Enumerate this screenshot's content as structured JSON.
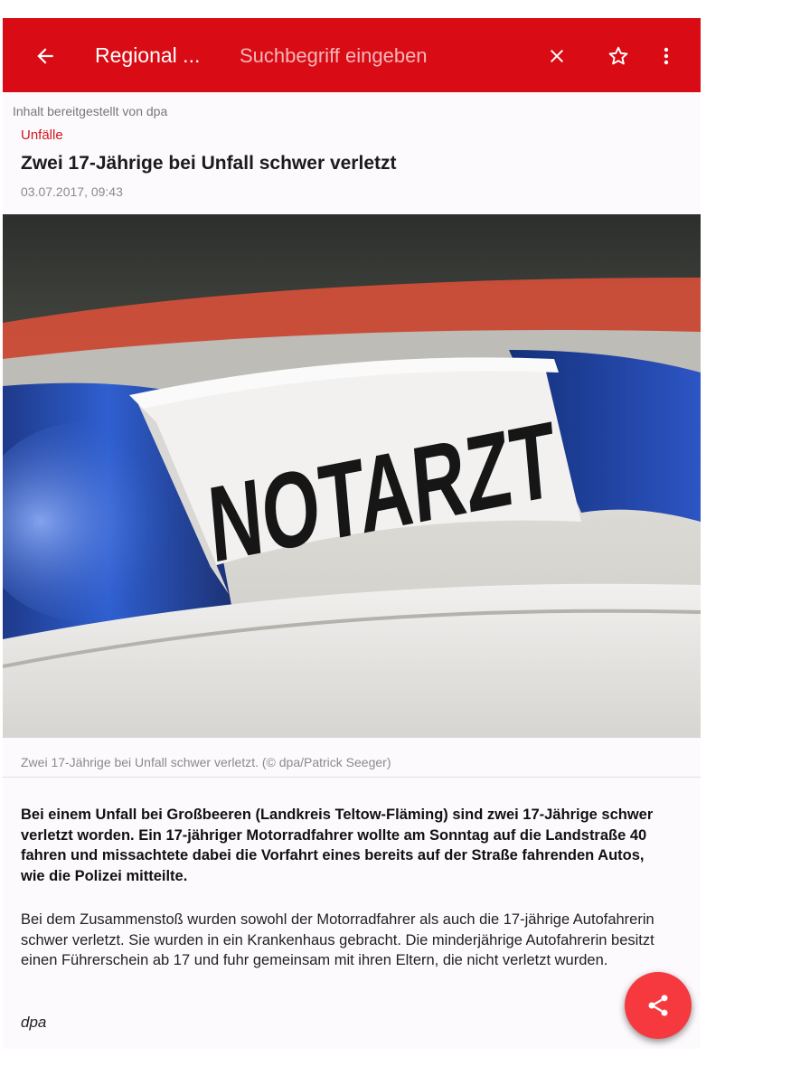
{
  "toolbar": {
    "title": "Regional ...",
    "search_placeholder": "Suchbegriff eingeben",
    "back_icon": "arrow-left-icon",
    "clear_icon": "close-icon",
    "favorite_icon": "star-outline-icon",
    "menu_icon": "more-vert-icon",
    "color": "#d90b14"
  },
  "article": {
    "provider": "Inhalt bereitgestellt von dpa",
    "category": "Unfälle",
    "headline": "Zwei 17-Jährige bei Unfall schwer verletzt",
    "date": "03.07.2017, 09:43",
    "photo": {
      "sign_text": "NOTARZT",
      "caption": "Zwei 17-Jährige bei Unfall schwer verletzt. (© dpa/Patrick Seeger)"
    },
    "lead": "Bei einem Unfall bei Großbeeren (Landkreis Teltow-Fläming) sind zwei 17-Jährige schwer verletzt worden. Ein 17-jähriger Motorradfahrer wollte am Sonntag auf die Landstraße 40 fahren und missachtete dabei die Vorfahrt eines bereits auf der Straße fahrenden Autos, wie die Polizei mitteilte.",
    "body": "Bei dem Zusammenstoß wurden sowohl der Motorradfahrer als auch die 17-jährige Autofahrerin schwer verletzt. Sie wurden in ein Krankenhaus gebracht. Die minderjährige Autofahrerin besitzt einen Führerschein ab 17 und fuhr gemeinsam mit ihren Eltern, die nicht verletzt wurden.",
    "author": "dpa"
  },
  "fab": {
    "icon": "share-icon",
    "color": "#f5393f"
  }
}
